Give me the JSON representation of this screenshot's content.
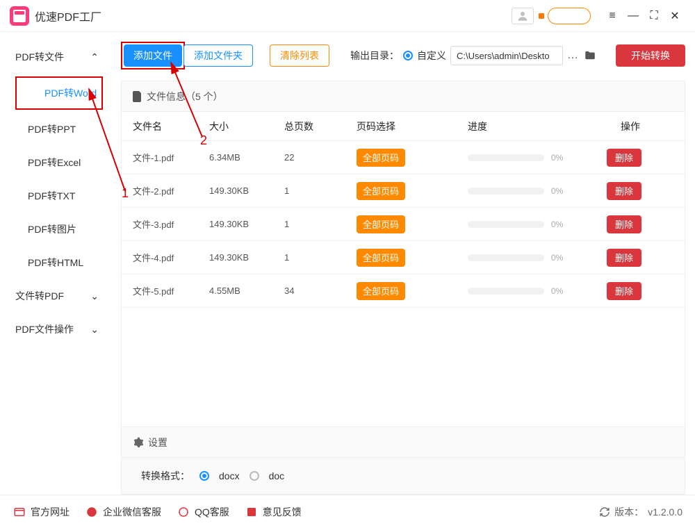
{
  "app": {
    "title": "优速PDF工厂"
  },
  "window_buttons": {
    "menu": "≡",
    "min": "—",
    "max": "⛶",
    "close": "✕"
  },
  "sidebar": {
    "groups": [
      {
        "label": "PDF转文件",
        "expanded": true,
        "chev": "⌃"
      },
      {
        "label": "文件转PDF",
        "expanded": false,
        "chev": "⌄"
      },
      {
        "label": "PDF文件操作",
        "expanded": false,
        "chev": "⌄"
      }
    ],
    "items": [
      {
        "label": "PDF转Word",
        "active": true
      },
      {
        "label": "PDF转PPT"
      },
      {
        "label": "PDF转Excel"
      },
      {
        "label": "PDF转TXT"
      },
      {
        "label": "PDF转图片"
      },
      {
        "label": "PDF转HTML"
      }
    ]
  },
  "toolbar": {
    "add_file": "添加文件",
    "add_folder": "添加文件夹",
    "clear": "清除列表",
    "output_label": "输出目录：",
    "custom": "自定义",
    "path_value": "C:\\Users\\admin\\Deskto",
    "more": "…",
    "start": "开始转换"
  },
  "table": {
    "header_label": "文件信息",
    "count_suffix": "（5 个）",
    "cols": {
      "name": "文件名",
      "size": "大小",
      "pages": "总页数",
      "sel": "页码选择",
      "prog": "进度",
      "op": "操作"
    },
    "sel_btn": "全部页码",
    "del_btn": "删除",
    "rows": [
      {
        "name": "文件-1.pdf",
        "size": "6.34MB",
        "pages": "22",
        "prog": "0%"
      },
      {
        "name": "文件-2.pdf",
        "size": "149.30KB",
        "pages": "1",
        "prog": "0%"
      },
      {
        "name": "文件-3.pdf",
        "size": "149.30KB",
        "pages": "1",
        "prog": "0%"
      },
      {
        "name": "文件-4.pdf",
        "size": "149.30KB",
        "pages": "1",
        "prog": "0%"
      },
      {
        "name": "文件-5.pdf",
        "size": "4.55MB",
        "pages": "34",
        "prog": "0%"
      }
    ]
  },
  "settings": {
    "title": "设置",
    "format_label": "转换格式：",
    "opt1": "docx",
    "opt2": "doc"
  },
  "footer": {
    "site": "官方网址",
    "wecom": "企业微信客服",
    "qq": "QQ客服",
    "feedback": "意见反馈",
    "version_label": "版本：",
    "version": "v1.2.0.0"
  },
  "annotations": {
    "one": "1",
    "two": "2"
  }
}
